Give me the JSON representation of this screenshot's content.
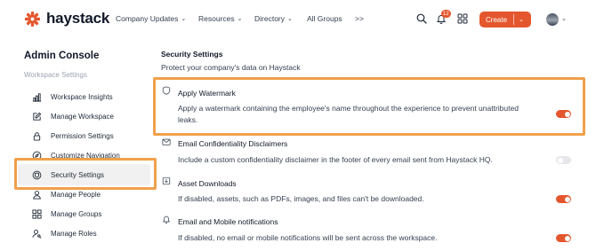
{
  "brand": {
    "name": "haystack",
    "accent": "#e4572e"
  },
  "nav": {
    "items": [
      {
        "label": "Company Updates",
        "has_dropdown": true
      },
      {
        "label": "Resources",
        "has_dropdown": true
      },
      {
        "label": "Directory",
        "has_dropdown": true
      },
      {
        "label": "All Groups",
        "has_dropdown": false
      }
    ],
    "more_label": ">>",
    "notification_count": "12",
    "create_label": "Create"
  },
  "sidebar": {
    "title": "Admin Console",
    "section_label": "Workspace Settings",
    "items": [
      {
        "label": "Workspace Insights",
        "icon": "bar-chart-icon"
      },
      {
        "label": "Manage Workspace",
        "icon": "edit-icon"
      },
      {
        "label": "Permission Settings",
        "icon": "lock-icon"
      },
      {
        "label": "Customize Navigation",
        "icon": "compass-icon"
      },
      {
        "label": "Security Settings",
        "icon": "shield-icon",
        "active": true
      },
      {
        "label": "Manage People",
        "icon": "person-icon"
      },
      {
        "label": "Manage Groups",
        "icon": "grid-icon"
      },
      {
        "label": "Manage Roles",
        "icon": "user-key-icon"
      }
    ]
  },
  "main": {
    "title": "Security Settings",
    "subtitle": "Protect your company's data on Haystack",
    "settings": [
      {
        "title": "Apply Watermark",
        "desc_line1": "Apply a watermark containing the employee's name throughout the experience to prevent unattributed",
        "desc_line2": "leaks.",
        "icon": "shield-icon",
        "enabled": true
      },
      {
        "title": "Email Confidentiality Disclaimers",
        "desc_line1": "Include a custom confidentiality disclaimer in the footer of every email sent from Haystack HQ.",
        "icon": "mail-icon",
        "enabled": false
      },
      {
        "title": "Asset Downloads",
        "desc_line1": "If disabled, assets, such as PDFs, images, and files can't be downloaded.",
        "icon": "download-icon",
        "enabled": true
      },
      {
        "title": "Email and Mobile notifications",
        "desc_line1": "If disabled, no email or mobile notifications will be sent across the workspace.",
        "icon": "bell-icon",
        "enabled": true
      }
    ]
  },
  "highlight_color": "#f0a04b"
}
